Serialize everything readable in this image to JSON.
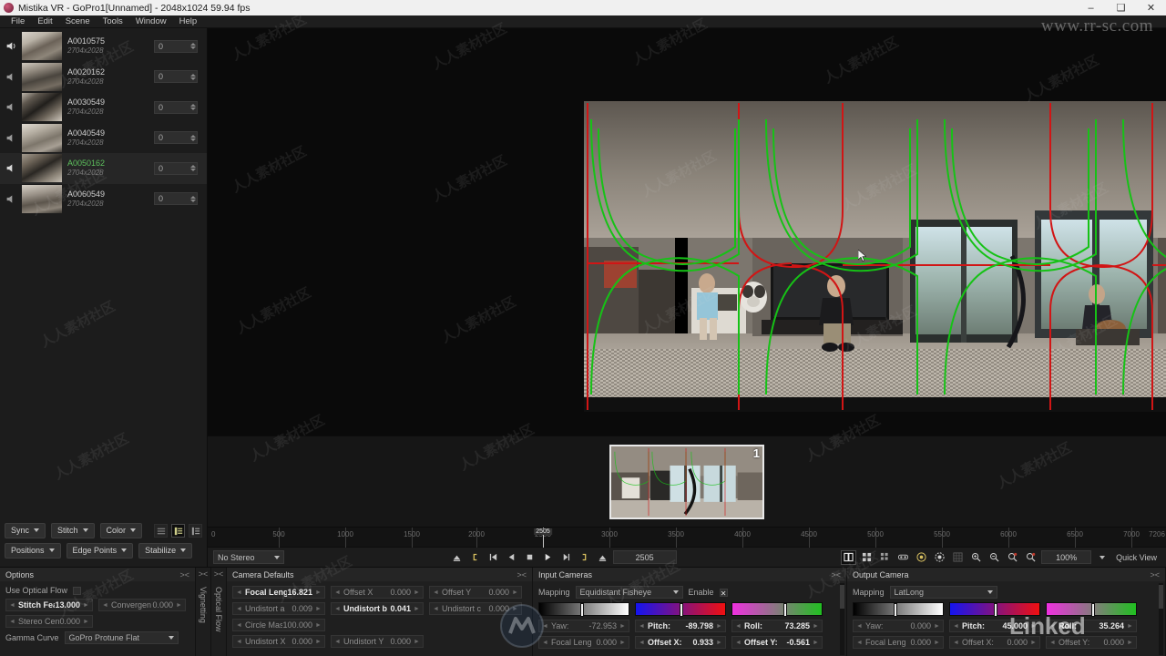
{
  "titlebar": {
    "title": "Mistika VR - GoPro1[Unnamed] - 2048x1024 59.94 fps",
    "minimize": "–",
    "maximize": "❑",
    "close": "✕"
  },
  "menubar": {
    "items": [
      "File",
      "Edit",
      "Scene",
      "Tools",
      "Window",
      "Help"
    ]
  },
  "clips": [
    {
      "name": "A0010575",
      "resolution": "2704x2028",
      "value": "0",
      "selected": false,
      "muted": false
    },
    {
      "name": "A0020162",
      "resolution": "2704x2028",
      "value": "0",
      "selected": false,
      "muted": true
    },
    {
      "name": "A0030549",
      "resolution": "2704x2028",
      "value": "0",
      "selected": false,
      "muted": true
    },
    {
      "name": "A0040549",
      "resolution": "2704x2028",
      "value": "0",
      "selected": false,
      "muted": true
    },
    {
      "name": "A0050162",
      "resolution": "2704x2028",
      "value": "0",
      "selected": true,
      "muted": false
    },
    {
      "name": "A0060549",
      "resolution": "2704x2028",
      "value": "0",
      "selected": false,
      "muted": true
    }
  ],
  "left_toolbar": {
    "row1": [
      "Sync",
      "Stitch",
      "Color"
    ],
    "row2": [
      "Positions",
      "Edge Points",
      "Stabilize"
    ],
    "view_modes": [
      "list-compact",
      "list-detail",
      "list-tree"
    ],
    "active_view_mode": 1
  },
  "filmstrip": {
    "selected_index_label": "1"
  },
  "ruler": {
    "start_label": "0",
    "ticks": [
      500,
      1000,
      1500,
      2000,
      2500,
      3000,
      3500,
      4000,
      4500,
      5000,
      5500,
      6000,
      6500,
      7000
    ],
    "end_label": "7206",
    "playhead_label": "2505"
  },
  "transport": {
    "stereo_mode": "No Stereo",
    "current_frame": "2505",
    "zoom_level": "100%",
    "quick_view": "Quick View",
    "buttons": [
      "set-in-marker",
      "jump-start",
      "step-back",
      "stop",
      "play",
      "step-forward",
      "set-out-marker",
      "jump-end"
    ],
    "view_buttons": [
      "single-view-icon",
      "quad-view-icon",
      "multi-view-icon",
      "stereo-view-icon",
      "fisheye-view-icon",
      "sphere-view-icon",
      "grid-overlay-icon",
      "zoom-in-icon",
      "zoom-out-icon",
      "zoom-reset-icon",
      "zoom-fit-icon"
    ]
  },
  "options_panel": {
    "title": "Options",
    "optical_flow_label": "Use Optical Flow",
    "optical_flow_checked": false,
    "fields": [
      {
        "name": "Stitch Featl",
        "value": "13.000",
        "active": true
      },
      {
        "name": "Convergen",
        "value": "0.000",
        "active": false
      },
      {
        "name": "Stereo Cen",
        "value": "0.000",
        "active": false
      }
    ],
    "gamma_label": "Gamma Curve",
    "gamma_value": "GoPro Protune Flat"
  },
  "vertical_tabs": [
    "Vignetting",
    "Optical Flow"
  ],
  "camera_defaults": {
    "title": "Camera Defaults",
    "fields": [
      {
        "name": "Focal Leng",
        "value": "16.821",
        "active": true
      },
      {
        "name": "Offset X",
        "value": "0.000",
        "active": false
      },
      {
        "name": "Offset Y",
        "value": "0.000",
        "active": false
      },
      {
        "name": "Undistort a",
        "value": "0.009",
        "active": false
      },
      {
        "name": "Undistort b",
        "value": "0.041",
        "active": true
      },
      {
        "name": "Undistort c",
        "value": "0.000",
        "active": false
      },
      {
        "name": "Circle Mask",
        "value": "100.000",
        "active": false
      },
      {
        "name": "Undistort X",
        "value": "0.000",
        "active": false
      },
      {
        "name": "Undistort Y",
        "value": "0.000",
        "active": false
      }
    ]
  },
  "input_cameras": {
    "title": "Input Cameras",
    "mapping_label": "Mapping",
    "mapping_value": "Equidistant Fisheye",
    "enable_label": "Enable",
    "enable_checked": true,
    "sliders": [
      {
        "name": "yaw-slider",
        "from": "#000000",
        "to": "#ffffff",
        "pos": 46
      },
      {
        "name": "pitch-slider",
        "from": "#1414f0",
        "to": "#f01010",
        "pos": 49
      },
      {
        "name": "roll-slider",
        "from": "#f030e0",
        "to": "#20c020",
        "pos": 57
      }
    ],
    "fields": [
      {
        "name": "Yaw:",
        "value": "-72.953",
        "active": false
      },
      {
        "name": "Pitch:",
        "value": "-89.798",
        "active": true
      },
      {
        "name": "Roll:",
        "value": "73.285",
        "active": true
      },
      {
        "name": "Focal Leng",
        "value": "0.000",
        "active": false
      },
      {
        "name": "Offset X:",
        "value": "0.933",
        "active": true
      },
      {
        "name": "Offset Y:",
        "value": "-0.561",
        "active": true
      }
    ]
  },
  "output_camera": {
    "title": "Output Camera",
    "mapping_label": "Mapping",
    "mapping_value": "LatLong",
    "sliders": [
      {
        "name": "yaw-slider",
        "from": "#000000",
        "to": "#ffffff",
        "pos": 45
      },
      {
        "name": "pitch-slider",
        "from": "#1414f0",
        "to": "#f01010",
        "pos": 49
      },
      {
        "name": "roll-slider",
        "from": "#f030e0",
        "to": "#20c020",
        "pos": 50
      }
    ],
    "fields": [
      {
        "name": "Yaw:",
        "value": "0.000",
        "active": false
      },
      {
        "name": "Pitch:",
        "value": "45.000",
        "active": true
      },
      {
        "name": "Roll:",
        "value": "35.264",
        "active": true
      },
      {
        "name": "Focal Leng",
        "value": "0.000",
        "active": false
      },
      {
        "name": "Offset X:",
        "value": "0.000",
        "active": false
      },
      {
        "name": "Offset Y:",
        "value": "0.000",
        "active": false
      }
    ]
  },
  "watermarks": {
    "url": "www.rr-sc.com",
    "tile": "人人素材社区",
    "linkedin": "Linked"
  },
  "colors": {
    "accent_green": "#5ec15e",
    "seam_green": "#16c216",
    "seam_red": "#d11515",
    "panel_bg": "#1f1f1f",
    "window_bg": "#1a1a1a"
  }
}
